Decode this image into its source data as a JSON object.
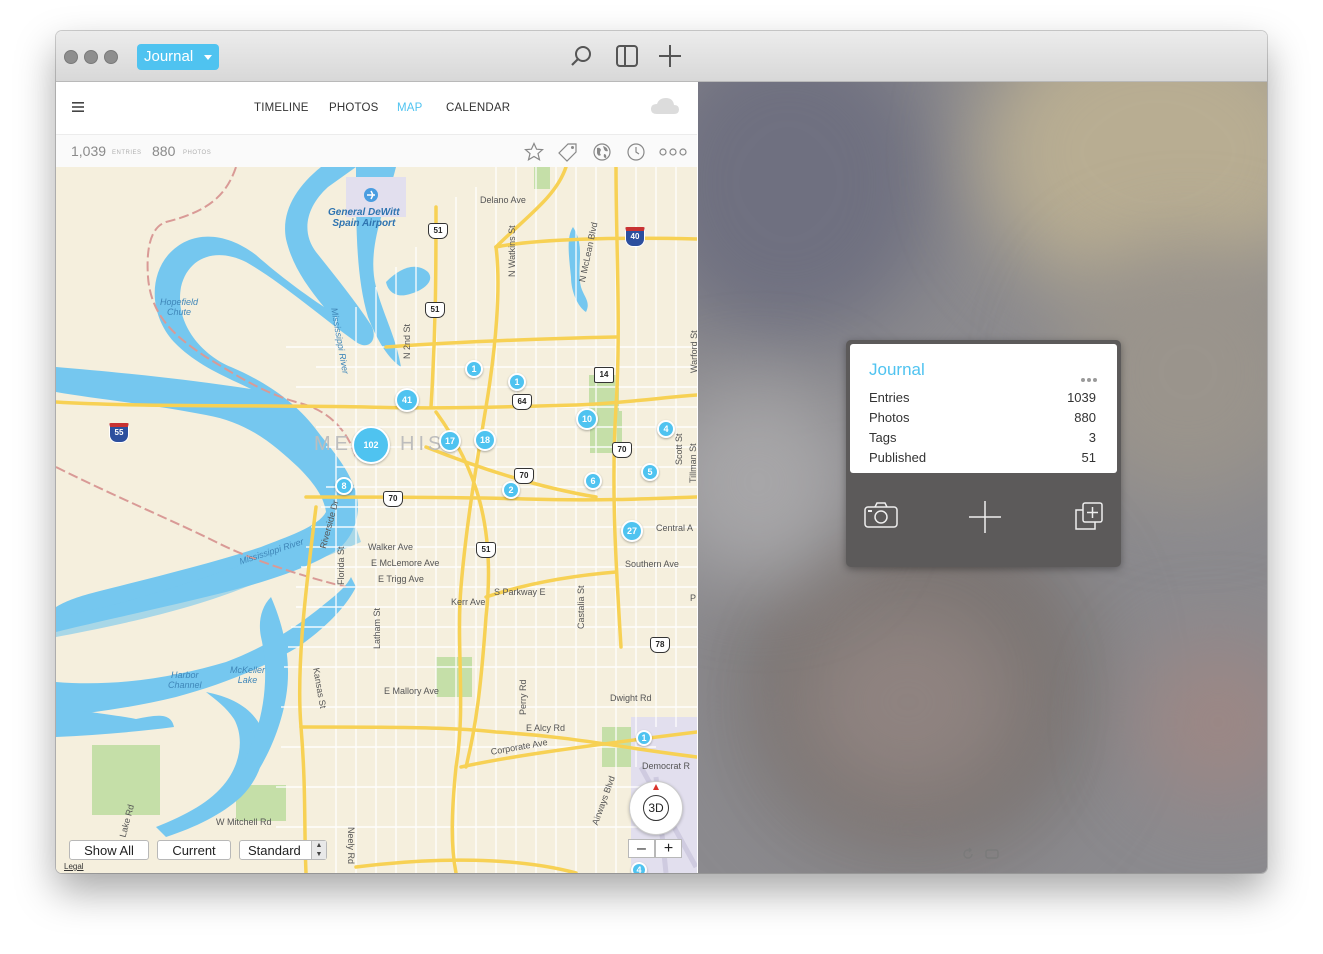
{
  "window": {
    "journal_button": "Journal"
  },
  "toolbar_icons": [
    "search-icon",
    "sidebar-toggle-icon",
    "plus-icon"
  ],
  "nav": {
    "tabs": [
      {
        "label": "TIMELINE",
        "active": false
      },
      {
        "label": "PHOTOS",
        "active": false
      },
      {
        "label": "MAP",
        "active": true
      },
      {
        "label": "CALENDAR",
        "active": false
      }
    ]
  },
  "stats": {
    "entries_count": "1,039",
    "entries_label": "ENTRIES",
    "photos_count": "880",
    "photos_label": "PHOTOS"
  },
  "filter_icons": [
    "star-icon",
    "tag-icon",
    "globe-icon",
    "clock-icon",
    "more-icon"
  ],
  "map": {
    "city_label_left": "ME",
    "city_label_right": "HIS",
    "airport": "General DeWitt\nSpain Airport",
    "water_labels": [
      "Mississippi River",
      "Mississippi River",
      "Hopefield\nChute",
      "Harbor\nChannel",
      "McKeller\nLake"
    ],
    "streets": [
      "Delano Ave",
      "N Watkins St",
      "N McLean Blvd",
      "Warford St",
      "N 2nd St",
      "Scott St",
      "Tillman St",
      "Central A",
      "Southern Ave",
      "Walker Ave",
      "E McLemore Ave",
      "E Trigg Ave",
      "S Parkway E",
      "Kerr Ave",
      "Florida St",
      "Latham St",
      "Castalia St",
      "E Mallory Ave",
      "Kansas St",
      "Perry Rd",
      "E Alcy Rd",
      "Corporate Ave",
      "Dwight Rd",
      "Democrat R",
      "Airways Blvd",
      "W Mitchell Rd",
      "Neely Rd",
      "Riverside Dr",
      "Horn Lake Rd",
      "P"
    ],
    "highway_shields": [
      "51",
      "51",
      "64",
      "70",
      "70",
      "70",
      "51",
      "78",
      "14"
    ],
    "interstate_shields": [
      "40",
      "55"
    ],
    "pins": [
      "1",
      "1",
      "41",
      "102",
      "17",
      "18",
      "10",
      "4",
      "5",
      "8",
      "2",
      "6",
      "27",
      "1",
      "4"
    ],
    "buttons": {
      "show_all": "Show All",
      "current": "Current",
      "standard": "Standard"
    },
    "legal": "Legal",
    "compass_label": "3D",
    "zoom_out": "–",
    "zoom_in": "+"
  },
  "journal_card": {
    "title": "Journal",
    "rows": [
      {
        "label": "Entries",
        "value": "1039"
      },
      {
        "label": "Photos",
        "value": "880"
      },
      {
        "label": "Tags",
        "value": "3"
      },
      {
        "label": "Published",
        "value": "51"
      }
    ],
    "action_icons": [
      "camera-icon",
      "plus-icon",
      "duplicate-icon"
    ]
  },
  "colors": {
    "accent": "#4fc3f0",
    "map_water": "#75c7ef",
    "map_land": "#f5efdd",
    "map_road": "#f7d154"
  }
}
